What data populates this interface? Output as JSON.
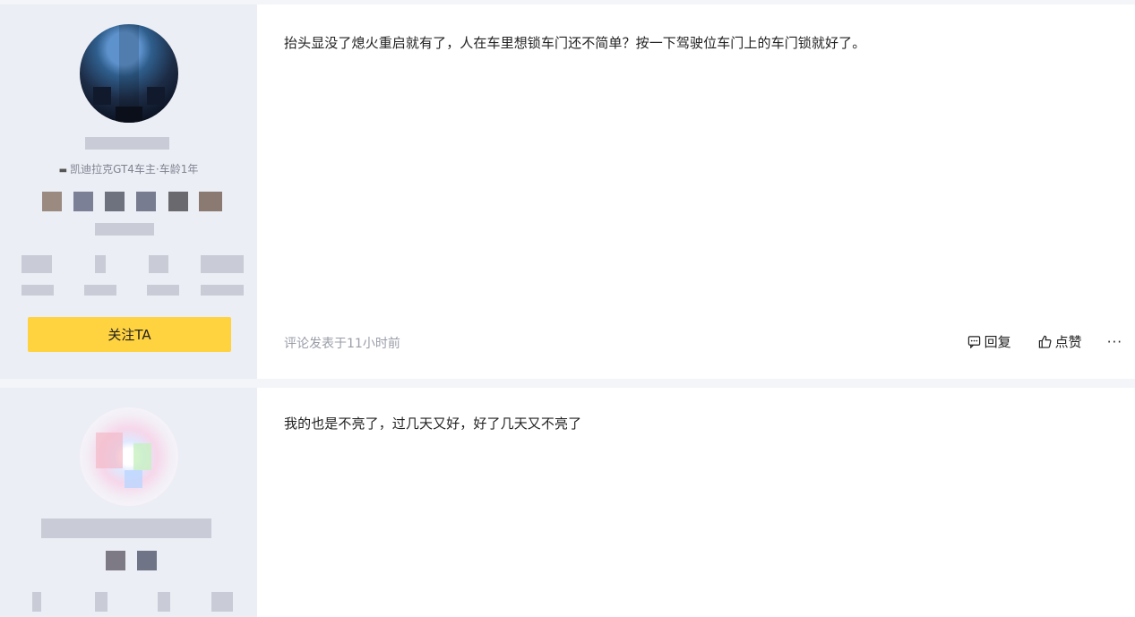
{
  "comments": [
    {
      "user": {
        "badge_icon": "cadillac-logo-icon",
        "badge": "凯迪拉克GT4车主·车龄1年"
      },
      "follow_label": "关注TA",
      "text": "抬头显没了熄火重启就有了，人在车里想锁车门还不简单？按一下驾驶位车门上的车门锁就好了。",
      "meta": "评论发表于11小时前",
      "actions": {
        "reply_icon": "comment-icon",
        "reply_label": "回复",
        "like_icon": "thumb-up-icon",
        "like_label": "点赞",
        "more_label": "···"
      }
    },
    {
      "text": "我的也是不亮了，过几天又好，好了几天又不亮了"
    }
  ],
  "colors": {
    "follow_button": "#ffd23f",
    "sidebar_bg": "#eceef5",
    "page_bg": "#f4f5f9",
    "meta_text": "#9a9da8"
  }
}
